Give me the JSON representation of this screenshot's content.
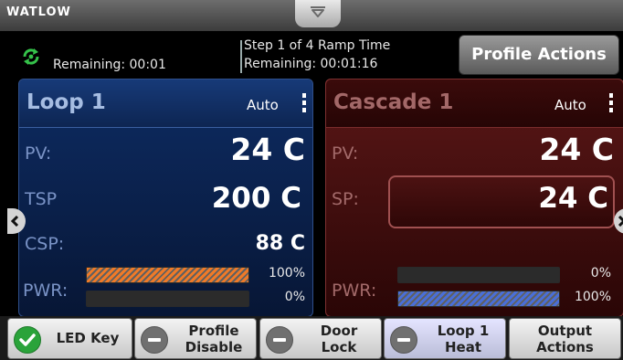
{
  "brand": "WATLOW",
  "status": {
    "remaining": "Remaining: 00:01",
    "step_line1": "Step 1 of 4 Ramp Time",
    "step_line2": "Remaining: 00:01:16",
    "profile_actions_label": "Profile Actions"
  },
  "loops": [
    {
      "title": "Loop 1",
      "mode": "Auto",
      "pv_label": "PV:",
      "pv_value": "24 C",
      "sp_label": "TSP",
      "sp_value": "200 C",
      "csp_label": "CSP:",
      "csp_value": "88 C",
      "pwr_label": "PWR:",
      "heat_power": 100,
      "heat_power_text": "100%",
      "cool_power": 0,
      "cool_power_text": "0%",
      "heat_color": "#f07a28",
      "cool_color": "#4a6fd8"
    },
    {
      "title": "Cascade 1",
      "mode": "Auto",
      "pv_label": "PV:",
      "pv_value": "24 C",
      "sp_label": "SP:",
      "sp_value": "24 C",
      "pwr_label": "PWR:",
      "heat_power": 0,
      "heat_power_text": "0%",
      "cool_power": 100,
      "cool_power_text": "100%",
      "heat_color": "#f07a28",
      "cool_color": "#4a6fd8"
    }
  ],
  "softkeys": [
    {
      "label_line1": "LED Key",
      "label_line2": "",
      "state": "on"
    },
    {
      "label_line1": "Profile",
      "label_line2": "Disable",
      "state": "off"
    },
    {
      "label_line1": "Door",
      "label_line2": "Lock",
      "state": "off"
    },
    {
      "label_line1": "Loop 1",
      "label_line2": "Heat",
      "state": "off"
    },
    {
      "label_line1": "Output",
      "label_line2": "Actions",
      "state": "none"
    }
  ],
  "icons": {
    "cycle": "cycle-arrows-icon",
    "pulltab": "chevron-down-icon",
    "menu": "kebab-menu-icon",
    "left": "chevron-left-icon",
    "right": "chevron-right-icon",
    "check": "check-icon",
    "minus": "minus-icon"
  },
  "colors": {
    "loop_panel": "#0e2c63",
    "cascade_panel": "#5b1717",
    "status_green": "#2aa33a"
  }
}
